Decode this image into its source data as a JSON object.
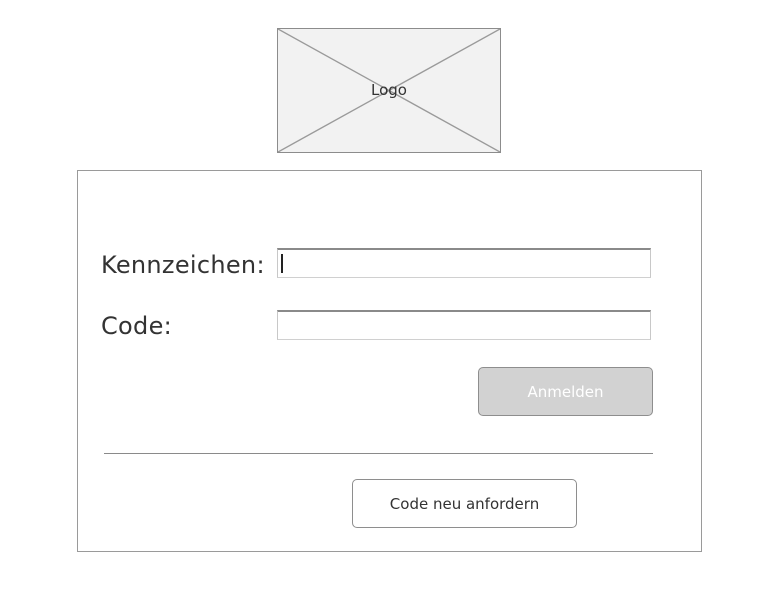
{
  "logo": {
    "label": "Logo"
  },
  "form": {
    "plate_label": "Kennzeichen:",
    "plate_value": "",
    "code_label": "Code:",
    "code_value": "",
    "login_button_label": "Anmelden",
    "resend_button_label": "Code neu anfordern"
  },
  "colors": {
    "login_button_bg": "#d2d2d2",
    "login_button_text": "#ffffff",
    "border": "#8e8e8e",
    "logo_bg": "#f2f2f2"
  }
}
